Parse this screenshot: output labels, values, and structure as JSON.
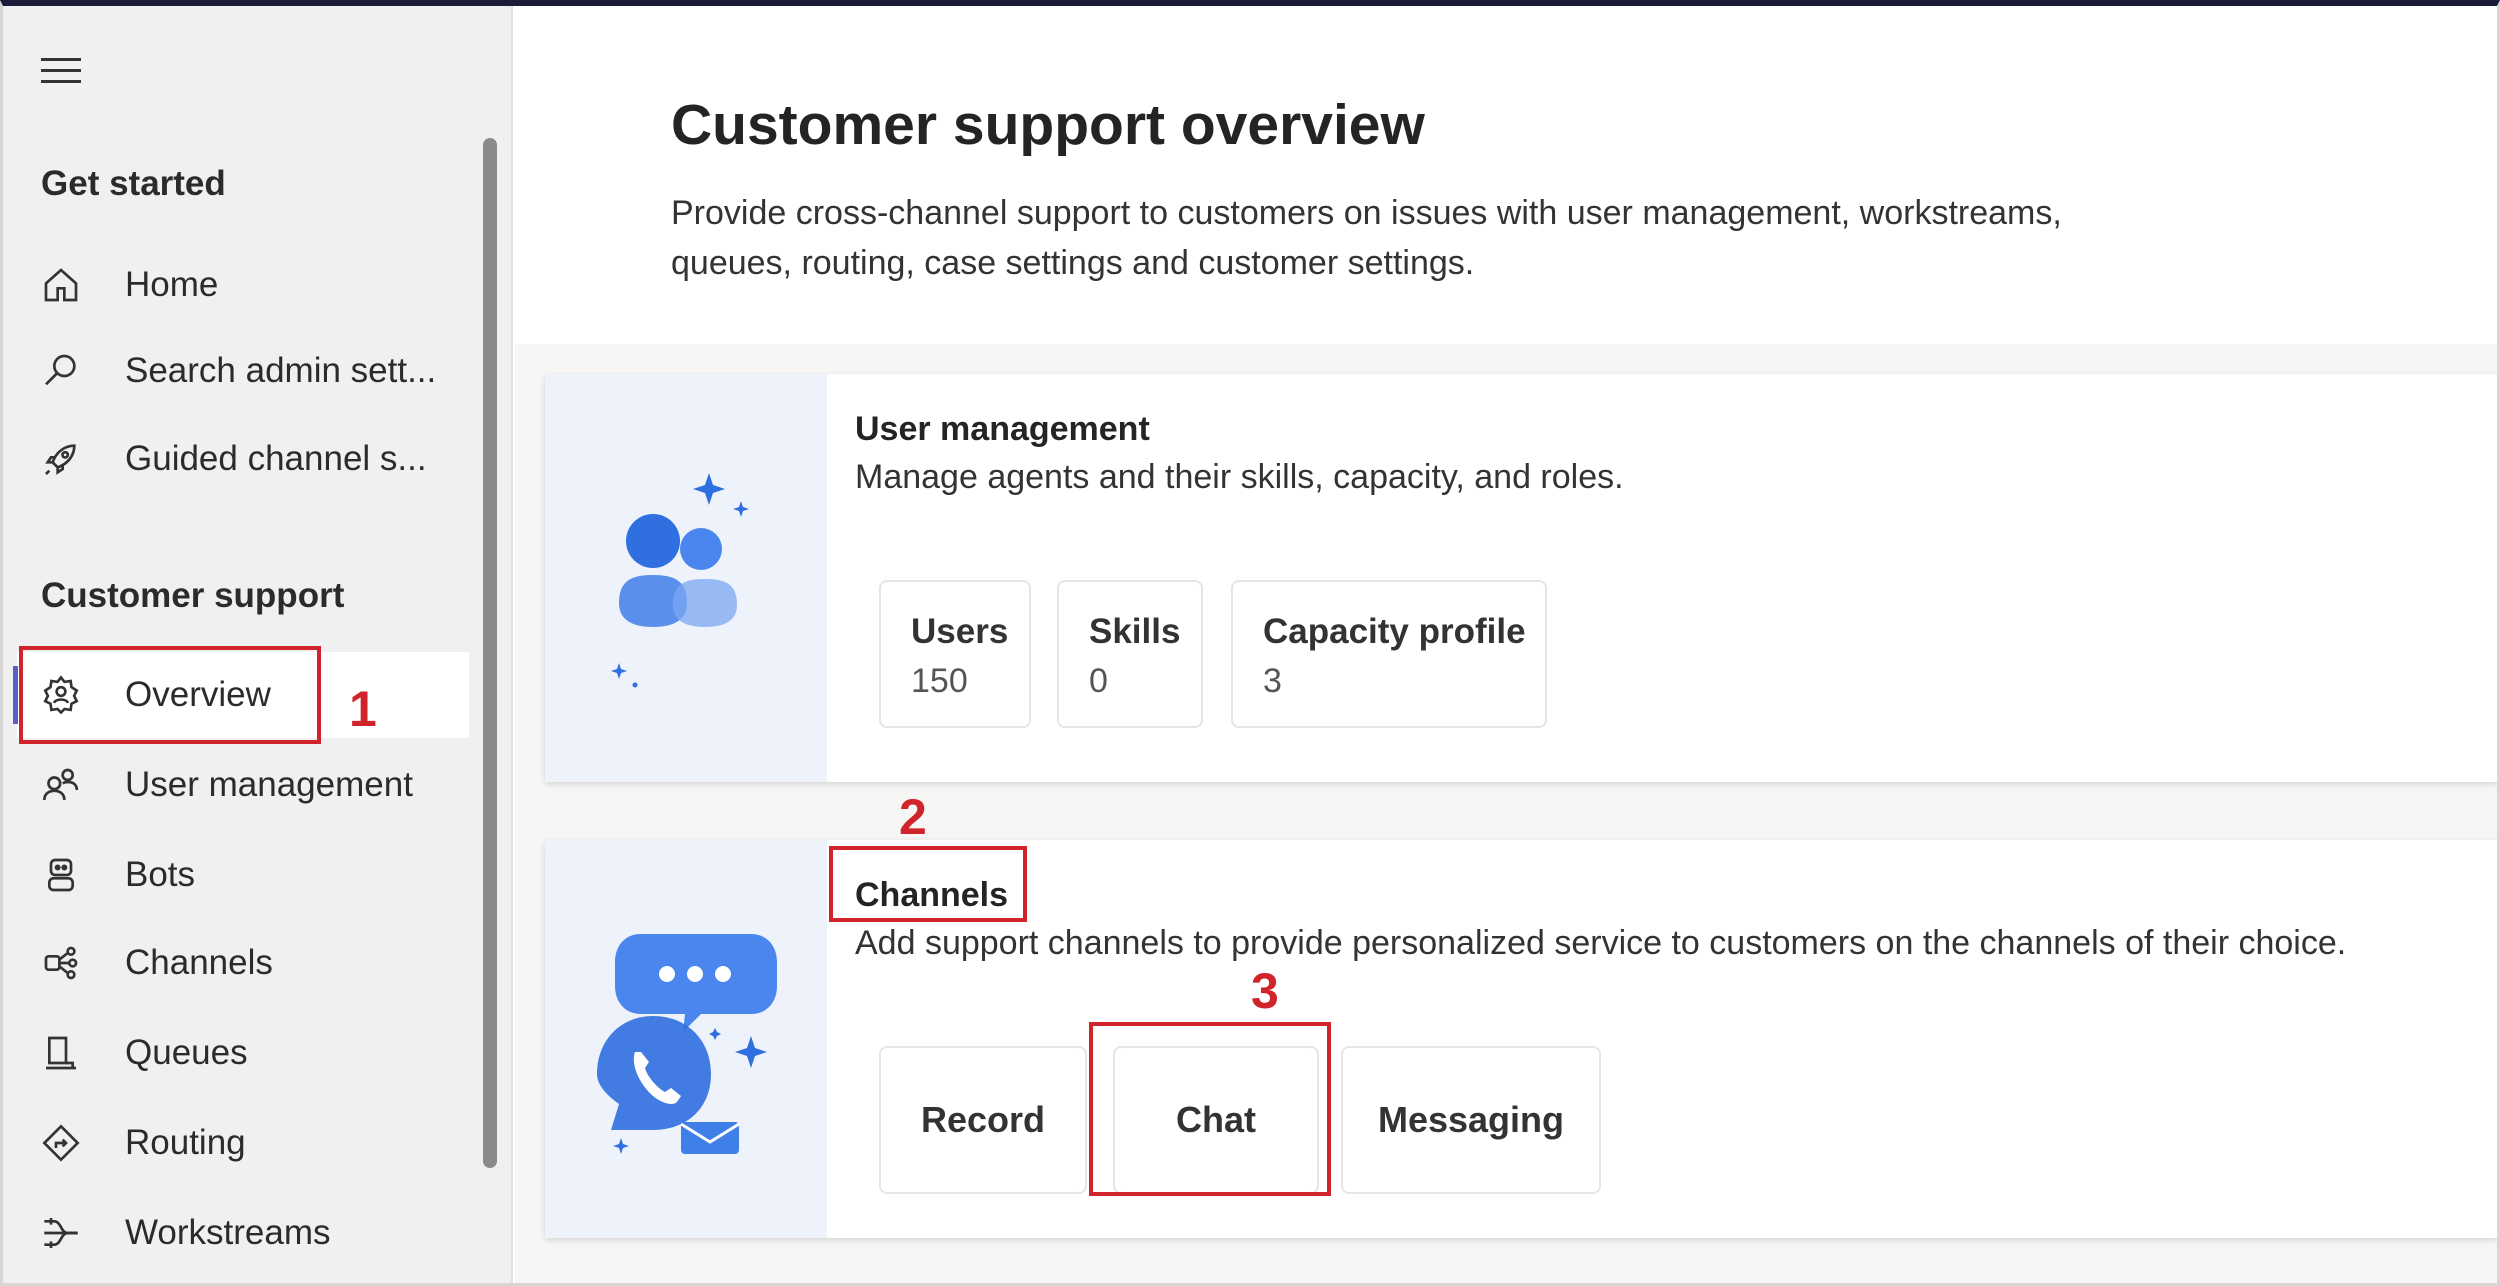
{
  "sidebar": {
    "menu_icon": "hamburger-icon",
    "sections": [
      {
        "title": "Get started",
        "items": [
          {
            "label": "Home",
            "icon": "home-icon"
          },
          {
            "label": "Search admin sett...",
            "icon": "search-icon"
          },
          {
            "label": "Guided channel s...",
            "icon": "rocket-icon"
          }
        ]
      },
      {
        "title": "Customer support",
        "items": [
          {
            "label": "Overview",
            "icon": "overview-gear-icon",
            "active": true
          },
          {
            "label": "User management",
            "icon": "user-management-icon"
          },
          {
            "label": "Bots",
            "icon": "bot-icon"
          },
          {
            "label": "Channels",
            "icon": "channels-icon"
          },
          {
            "label": "Queues",
            "icon": "queue-icon"
          },
          {
            "label": "Routing",
            "icon": "routing-icon"
          },
          {
            "label": "Workstreams",
            "icon": "workstreams-icon"
          }
        ]
      }
    ]
  },
  "main": {
    "title": "Customer support overview",
    "description": "Provide cross-channel support to customers on issues with user management, workstreams, queues, routing, case settings and customer settings.",
    "cards": [
      {
        "title": "User management",
        "description": "Manage agents and their skills, capacity, and roles.",
        "illustration": "people-illustration",
        "tiles": [
          {
            "label": "Users",
            "value": "150"
          },
          {
            "label": "Skills",
            "value": "0"
          },
          {
            "label": "Capacity profile",
            "value": "3"
          }
        ]
      },
      {
        "title": "Channels",
        "description": "Add support channels to provide personalized service to customers on the channels of their choice.",
        "illustration": "chat-phone-illustration",
        "tiles": [
          {
            "label": "Record"
          },
          {
            "label": "Chat"
          },
          {
            "label": "Messaging"
          }
        ]
      }
    ]
  },
  "annotations": {
    "step1": "1",
    "step2": "2",
    "step3": "3",
    "color": "#d0242c"
  },
  "colors": {
    "accent": "#5b5fc7",
    "illustration_blue": "#2f6fe0"
  }
}
